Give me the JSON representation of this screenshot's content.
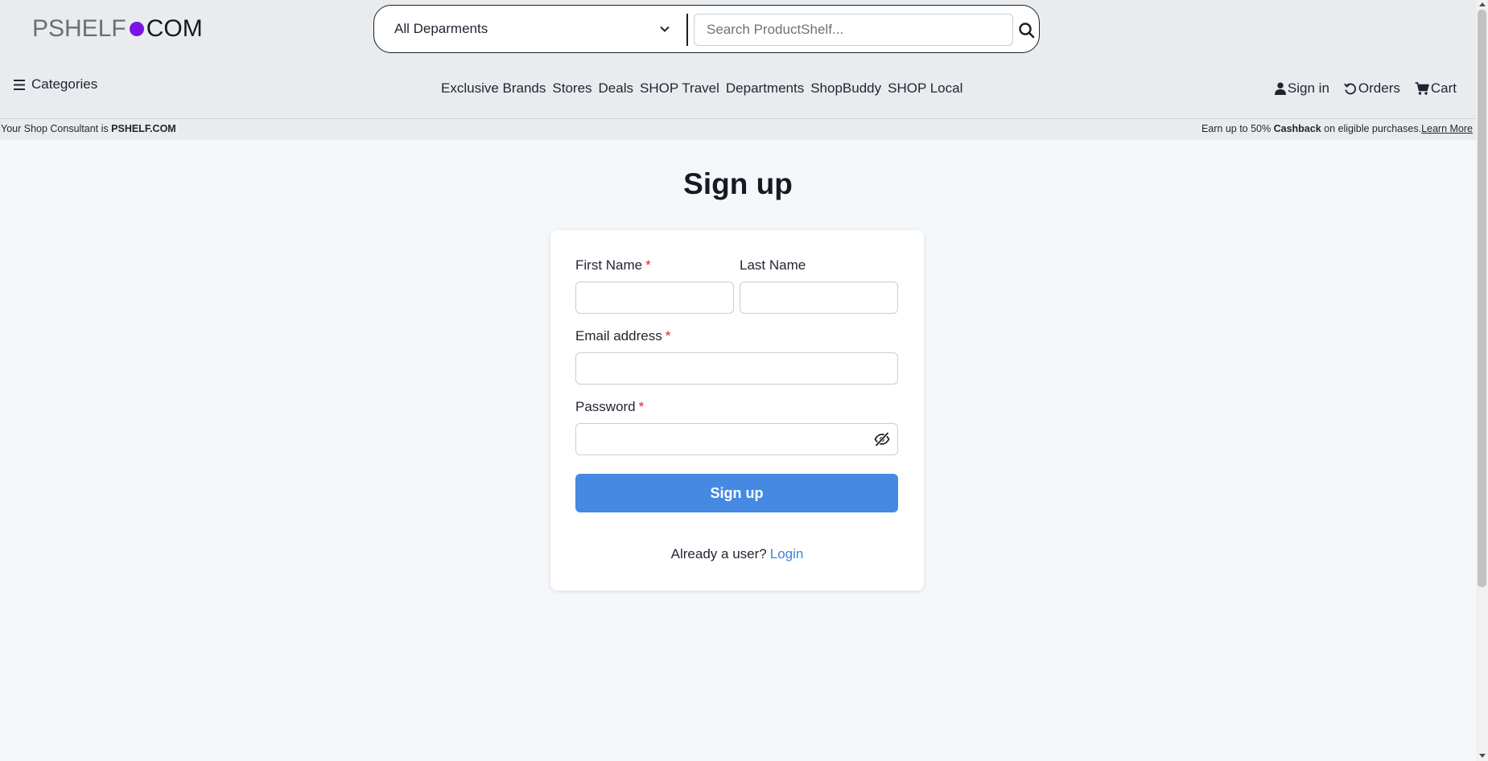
{
  "header": {
    "logo": {
      "part1": "PSHELF",
      "part2": "COM"
    },
    "department_select": {
      "value": "All Deparments"
    },
    "search": {
      "placeholder": "Search ProductShelf..."
    },
    "categories_label": "Categories",
    "nav": [
      "Exclusive Brands",
      "Stores",
      "Deals",
      "SHOP Travel",
      "Departments",
      "ShopBuddy",
      "SHOP Local"
    ],
    "account": {
      "sign_in": "Sign in",
      "orders": "Orders",
      "cart": "Cart"
    }
  },
  "strip": {
    "left_prefix": "Your Shop Consultant is ",
    "left_bold": "PSHELF.COM",
    "right_prefix": "Earn up to 50% ",
    "right_bold": "Cashback",
    "right_suffix": " on eligible purchases.",
    "learn_more": "Learn More"
  },
  "main": {
    "title": "Sign up",
    "form": {
      "first_name_label": "First Name",
      "last_name_label": "Last Name",
      "email_label": "Email address",
      "password_label": "Password",
      "required_mark": "*",
      "first_name_value": "",
      "last_name_value": "",
      "email_value": "",
      "password_value": "",
      "submit_label": "Sign up",
      "already_text": "Already a user?",
      "login_link": "Login"
    }
  },
  "colors": {
    "accent_button": "#4589e3",
    "link": "#3b86d8",
    "logo_dot": "#7c12e6",
    "required": "#dc1f2a",
    "header_bg": "#e9ecef"
  }
}
